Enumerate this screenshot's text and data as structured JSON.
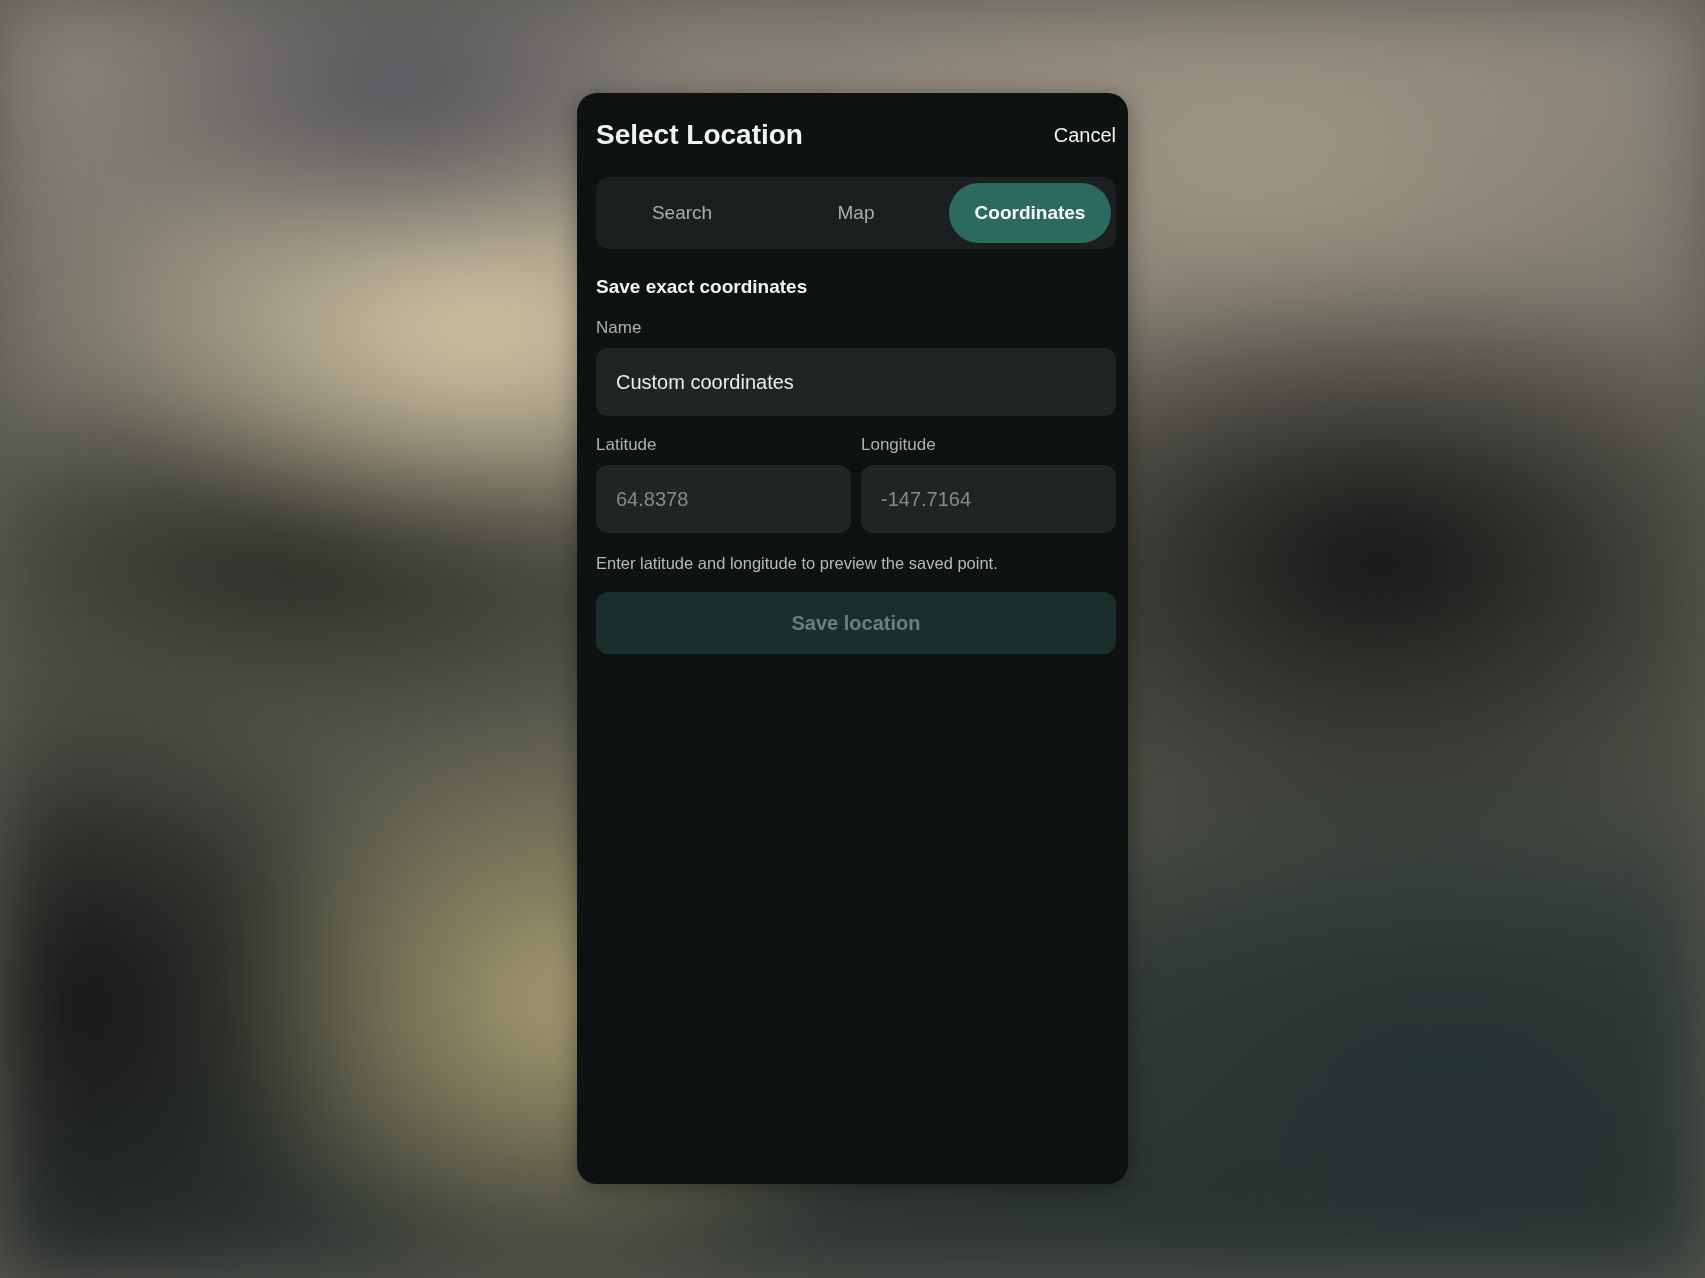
{
  "dialog": {
    "title": "Select Location",
    "cancel": "Cancel"
  },
  "tabs": [
    {
      "label": "Search",
      "selected": false
    },
    {
      "label": "Map",
      "selected": false
    },
    {
      "label": "Coordinates",
      "selected": true
    }
  ],
  "form": {
    "heading": "Save exact coordinates",
    "fields": [
      {
        "label": "Name",
        "value": "Custom coordinates"
      },
      {
        "label": "Latitude",
        "placeholder": "64.8378"
      },
      {
        "label": "Longitude",
        "placeholder": "-147.7164"
      }
    ],
    "hint": "Enter latitude and longitude to preview the saved point.",
    "save_button": {
      "label": "Save location",
      "disabled": true
    }
  }
}
